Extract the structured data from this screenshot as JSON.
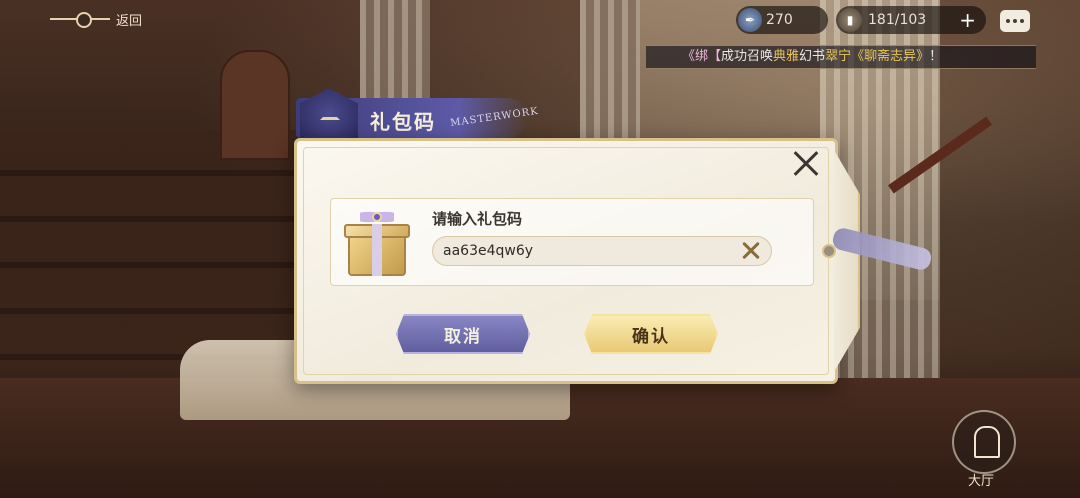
{
  "topbar": {
    "back_label": "返回",
    "quill_count": "270",
    "ticket_count": "181/103",
    "plus_label": "+"
  },
  "marquee": {
    "prefix": "《绑【",
    "name": "",
    "text1": "成功召唤",
    "highlight1": "典雅",
    "text2": "幻书",
    "highlight2": "翠宁《聊斋志异》",
    "suffix": "！"
  },
  "dialog": {
    "title": "礼包码",
    "ribbon_text": "MASTERWORK",
    "input_label": "请输入礼包码",
    "input_value": "aa63e4qw6y",
    "cancel_label": "取消",
    "confirm_label": "确认"
  },
  "lobby": {
    "label": "大厅"
  },
  "icons": {
    "close": "close-icon",
    "clear": "clear-icon",
    "gift": "gift-box-icon",
    "quill": "quill-icon",
    "ticket": "ticket-icon",
    "chat": "chat-icon",
    "lobby": "lobby-icon"
  },
  "colors": {
    "cancel_button": "#6f6cb0",
    "confirm_button": "#f0d98f",
    "card_border": "#d7c089"
  }
}
